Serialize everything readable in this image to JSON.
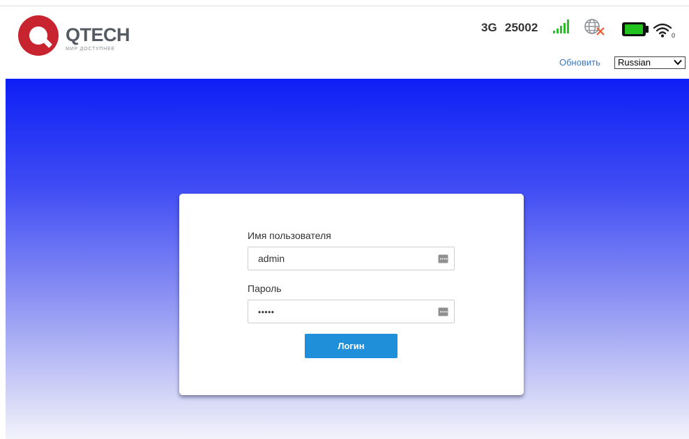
{
  "brand": {
    "name": "QTECH",
    "tagline": "МИР ДОСТУПНЕЕ",
    "color": "#c8242f"
  },
  "status": {
    "network_type": "3G",
    "operator": "25002",
    "signal_icon": "signal-bars-icon",
    "network_icon": "globe-disconnected-icon",
    "battery_icon": "battery-icon",
    "wifi_icon": "wifi-icon",
    "wifi_clients": "0",
    "signal_color": "#2bbf2b",
    "battery_color": "#22c21f"
  },
  "header": {
    "refresh_label": "Обновить",
    "language": {
      "selected": "Russian"
    }
  },
  "login": {
    "username_label": "Имя пользователя",
    "username_value": "admin",
    "password_label": "Пароль",
    "password_value": "•••••",
    "submit_label": "Логин",
    "button_color": "#1e8fd8"
  }
}
